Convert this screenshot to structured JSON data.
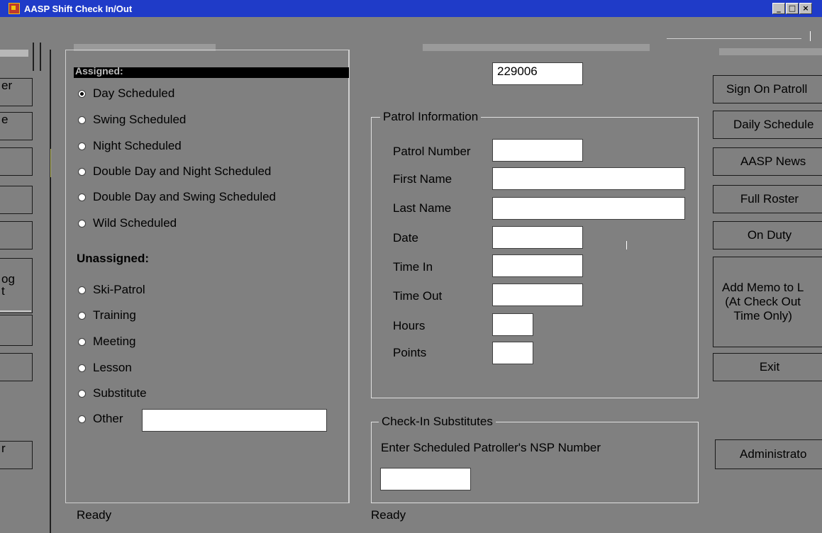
{
  "window": {
    "title": "AASP Shift Check In/Out",
    "controls": {
      "minimize": "_",
      "maximize": "□",
      "close": "×"
    }
  },
  "left_buttons": [
    "er",
    "e",
    "",
    "",
    "",
    "og\nt",
    "",
    "",
    "r"
  ],
  "assigned": {
    "heading": "Assigned:",
    "options": [
      {
        "label": "Day Scheduled",
        "selected": true
      },
      {
        "label": "Swing Scheduled",
        "selected": false
      },
      {
        "label": "Night Scheduled",
        "selected": false
      },
      {
        "label": "Double Day and Night Scheduled",
        "selected": false
      },
      {
        "label": "Double Day and Swing Scheduled",
        "selected": false
      },
      {
        "label": "Wild Scheduled",
        "selected": false
      }
    ]
  },
  "unassigned": {
    "heading": "Unassigned:",
    "options": [
      {
        "label": "Ski-Patrol"
      },
      {
        "label": "Training"
      },
      {
        "label": "Meeting"
      },
      {
        "label": "Lesson"
      },
      {
        "label": "Substitute"
      },
      {
        "label": "Other"
      }
    ],
    "other_value": ""
  },
  "nsp_number": "229006",
  "patrol_info": {
    "title": "Patrol Information",
    "fields": {
      "patrol_number": {
        "label": "Patrol Number",
        "value": ""
      },
      "first_name": {
        "label": "First Name",
        "value": ""
      },
      "last_name": {
        "label": "Last Name",
        "value": ""
      },
      "date": {
        "label": "Date",
        "value": ""
      },
      "time_in": {
        "label": "Time In",
        "value": ""
      },
      "time_out": {
        "label": "Time Out",
        "value": ""
      },
      "hours": {
        "label": "Hours",
        "value": ""
      },
      "points": {
        "label": "Points",
        "value": ""
      }
    }
  },
  "substitutes": {
    "title": "Check-In Substitutes",
    "prompt": "Enter Scheduled Patroller's NSP Number",
    "value": ""
  },
  "right_buttons": {
    "sign_on": "Sign On Patroll",
    "daily_schedule": "Daily Schedule",
    "news": "AASP News",
    "full_roster": "Full Roster",
    "on_duty": "On Duty",
    "add_memo": "Add Memo to L\n(At Check Out\nTime Only)",
    "exit": "Exit",
    "administrator": "Administrato"
  },
  "status": {
    "left": "Ready",
    "right": "Ready"
  },
  "colors": {
    "titlebar": "#1f3bc8",
    "background": "#808080"
  }
}
